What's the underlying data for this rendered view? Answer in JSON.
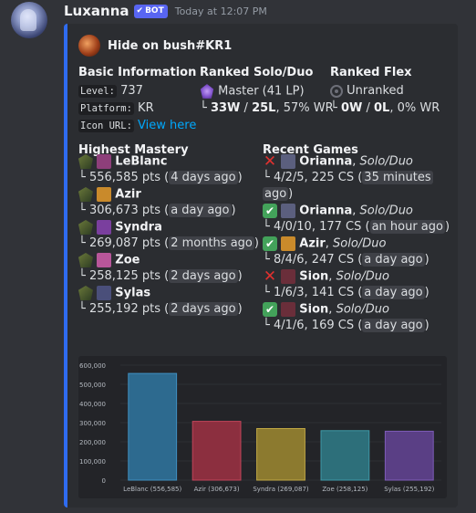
{
  "message": {
    "username": "Luxanna",
    "bot_label": "BOT",
    "timestamp": "Today at 12:07 PM",
    "avatar_icon": "lux-avatar-icon"
  },
  "embed": {
    "accent": "#2f6cf0",
    "author": "Hide on bush#KR1",
    "basic": {
      "title": "Basic Information",
      "level_label": "Level:",
      "level": "737",
      "platform_label": "Platform:",
      "platform": "KR",
      "icon_label": "Icon URL:",
      "icon_link": "View here"
    },
    "solo": {
      "title": "Ranked Solo/Duo",
      "rank": "Master (41 LP)",
      "wins": "33W",
      "sep": " / ",
      "losses": "25L",
      "wr": ", 57% WR"
    },
    "flex": {
      "title": "Ranked Flex",
      "rank": "Unranked",
      "wins": "0W",
      "sep": " / ",
      "losses": "0L",
      "wr": ", 0% WR"
    },
    "mastery": {
      "title": "Highest Mastery",
      "items": [
        {
          "champ": "LeBlanc",
          "pts": "556,585 pts (",
          "ago": "4 days ago",
          "close": ")",
          "color": "#8d3f7a"
        },
        {
          "champ": "Azir",
          "pts": "306,673 pts (",
          "ago": "a day ago",
          "close": ")",
          "color": "#c98a2b"
        },
        {
          "champ": "Syndra",
          "pts": "269,087 pts (",
          "ago": "2 months ago",
          "close": ")",
          "color": "#7a3f9e"
        },
        {
          "champ": "Zoe",
          "pts": "258,125 pts (",
          "ago": "2 days ago",
          "close": ")",
          "color": "#b8569a"
        },
        {
          "champ": "Sylas",
          "pts": "255,192 pts (",
          "ago": "2 days ago",
          "close": ")",
          "color": "#4a4f7a"
        }
      ]
    },
    "recent": {
      "title": "Recent Games",
      "games": [
        {
          "result": "loss",
          "champ": "Orianna",
          "mode": "Solo/Duo",
          "stats": "4/2/5, 225 CS (",
          "ago_a": "35 minutes",
          "ago_b": "ago",
          "close": ")",
          "color": "#5b5f7e"
        },
        {
          "result": "win",
          "champ": "Orianna",
          "mode": "Solo/Duo",
          "stats": "4/0/10, 177 CS (",
          "ago_a": "an hour ago",
          "close": ")",
          "color": "#5b5f7e"
        },
        {
          "result": "win",
          "champ": "Azir",
          "mode": "Solo/Duo",
          "stats": "8/4/6, 247 CS (",
          "ago_a": "a day ago",
          "close": ")",
          "color": "#c98a2b"
        },
        {
          "result": "loss",
          "champ": "Sion",
          "mode": "Solo/Duo",
          "stats": "1/6/3, 141 CS (",
          "ago_a": "a day ago",
          "close": ")",
          "color": "#6a2e3a"
        },
        {
          "result": "win",
          "champ": "Sion",
          "mode": "Solo/Duo",
          "stats": "4/1/6, 169 CS (",
          "ago_a": "a day ago",
          "close": ")",
          "color": "#6a2e3a"
        }
      ]
    },
    "tree_glyph": "└",
    "paren_close": ")"
  },
  "chart_data": {
    "type": "bar",
    "categories": [
      "LeBlanc (556,585)",
      "Azir (306,673)",
      "Syndra (269,087)",
      "Zoe (258,125)",
      "Sylas (255,192)"
    ],
    "values": [
      556585,
      306673,
      269087,
      258125,
      255192
    ],
    "ylim": [
      0,
      600000
    ],
    "yticks": [
      0,
      100000,
      200000,
      300000,
      400000,
      500000,
      600000
    ],
    "ytick_labels": [
      "0",
      "100,000",
      "200,000",
      "300,000",
      "400,000",
      "500,000",
      "600,000"
    ],
    "colors": [
      "#2d6a8f",
      "#8c2f3f",
      "#8c7a2f",
      "#2d6f7a",
      "#5a3f85"
    ],
    "strokes": [
      "#3f8fc0",
      "#c0455a",
      "#c0a845",
      "#3f9aa8",
      "#7d5cb8"
    ],
    "grid": true
  }
}
